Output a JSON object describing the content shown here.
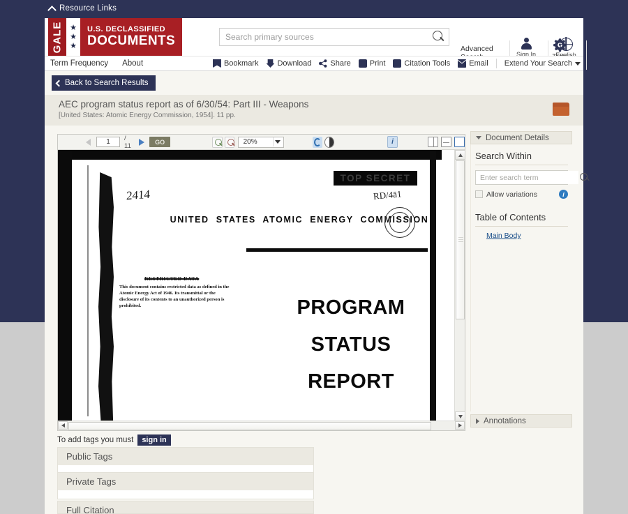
{
  "top_bar": {
    "resource_links_label": "Resource Links",
    "chevron_icon": "chevron-up-icon"
  },
  "brand": {
    "gale": "GALE",
    "line1": "U.S. DECLASSIFIED",
    "line2": "DOCUMENTS",
    "star": "★",
    "colors": {
      "dark_red": "#9e1b20",
      "red": "#a81f24",
      "navy": "#2d3356"
    }
  },
  "search": {
    "placeholder": "Search primary sources",
    "value": "",
    "icon": "search-icon",
    "advanced_search": "Advanced\nSearch",
    "advanced_search_line1": "Advanced",
    "advanced_search_line2": "Search"
  },
  "header_tools": [
    {
      "label": "Sign In",
      "icon": "person-icon"
    },
    {
      "label": "English",
      "icon": "globe-icon"
    },
    {
      "label": "Tools",
      "icon": "gear-icon"
    }
  ],
  "utility_bar": {
    "left": [
      {
        "label": "Term Frequency"
      },
      {
        "label": "About"
      }
    ],
    "right": [
      {
        "label": "Bookmark",
        "icon": "bookmark-icon"
      },
      {
        "label": "Download",
        "icon": "download-icon"
      },
      {
        "label": "Share",
        "icon": "share-icon"
      },
      {
        "label": "Print",
        "icon": "printer-icon"
      },
      {
        "label": "Citation Tools",
        "icon": "citation-icon"
      },
      {
        "label": "Email",
        "icon": "email-icon"
      }
    ],
    "extend": {
      "label": "Extend Your Search",
      "icon": "caret-down-icon"
    }
  },
  "back_button": {
    "label": "Back to Search Results",
    "icon": "chevron-left-icon"
  },
  "document": {
    "title": "AEC program status report as of 6/30/54: Part III - Weapons",
    "subtitle": "[United States: Atomic Energy Commission, 1954]. 11 pp.",
    "folder_icon": "folder-icon"
  },
  "viewer_toolbar": {
    "prev_icon": "arrow-left-icon",
    "next_icon": "arrow-right-icon",
    "page_value": "1",
    "page_total": "/ 11",
    "go_label": "GO",
    "zoom_in_icon": "zoom-in-icon",
    "zoom_out_icon": "zoom-out-icon",
    "zoom_value": "20%",
    "zoom_caret_icon": "caret-down-icon",
    "rotate_icon": "rotate-icon",
    "contrast_icon": "contrast-icon",
    "info_icon": "info-icon",
    "layout_two_page_icon": "two-page-layout-icon",
    "layout_rows_icon": "row-layout-icon",
    "layout_fit_icon": "fit-page-icon"
  },
  "scan_page": {
    "doc_number": "2414",
    "classification_stamp": "TOP SECRET",
    "rd_marking": "RD/4ā1",
    "agency": "UNITED STATES ATOMIC ENERGY COMMISSION",
    "restricted_heading": "RESTRICTED DATA",
    "restricted_body": "This document contains restricted data as defined in the Atomic Energy Act of 1946. Its transmittal or the disclosure of its contents to an unauthorized person is prohibited.",
    "big_title_line1": "PROGRAM",
    "big_title_line2": "STATUS",
    "big_title_line3": "REPORT"
  },
  "right_panel": {
    "details_header": "Document Details",
    "details_toggle_icon": "triangle-down-icon",
    "search_within_title": "Search Within",
    "search_within_placeholder": "Enter search term",
    "search_within_value": "",
    "search_within_icon": "search-icon",
    "allow_variations_label": "Allow variations",
    "allow_variations_checked": false,
    "info_icon": "info-icon",
    "toc_title": "Table of Contents",
    "toc_items": [
      {
        "label": "Main Body"
      }
    ],
    "annotations_header": "Annotations",
    "annotations_toggle_icon": "triangle-right-icon"
  },
  "tags": {
    "note_prefix": "To add tags you must",
    "signin_label": "sign in",
    "blocks": [
      {
        "title": "Public Tags"
      },
      {
        "title": "Private Tags"
      },
      {
        "title": "Full Citation"
      }
    ]
  }
}
